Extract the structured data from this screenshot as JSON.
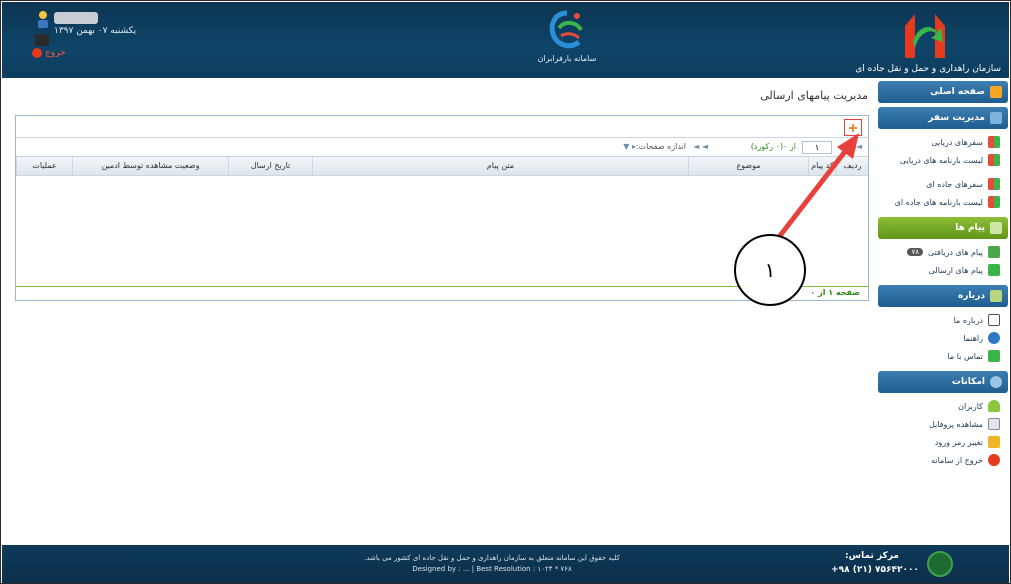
{
  "header": {
    "date": "یکشنبه ۰۷ بهمن ۱۳۹۷",
    "exit_label": "خروج",
    "center_logo_text": "سامانه بارفرابران",
    "org_name": "سازمان راهداری و حمل و نقل جاده ای"
  },
  "sidebar": {
    "home": "صفحه اصلی",
    "trip_management": "مدیریت سفر",
    "trip_items": [
      "سفرهای دریایی",
      "لیست بارنامه های دریایی",
      "سفرهای جاده ای",
      "لیست بارنامه های جاده ای"
    ],
    "messages": "پیام ها",
    "received_messages": "پیام های دریافتی",
    "received_badge": "۷۸",
    "sent_messages": "پیام های ارسالی",
    "about": "درباره",
    "about_items": [
      "درباره ما",
      "راهنما",
      "تماس با ما"
    ],
    "facilities": "امکانات",
    "facility_items": [
      "کاربران",
      "مشاهده پروفایل",
      "تغییر رمز ورود",
      "خروج از سامانه"
    ]
  },
  "main": {
    "page_title": "مدیریت پیامهای ارسالی",
    "pager": {
      "page_value": "۱",
      "of_text": "از ۰(۰ رکورد)",
      "page_size_label": "اندازه صفحات:"
    },
    "columns": [
      "ردیف",
      "کد پیام",
      "موضوع",
      "متن پیام",
      "تاریخ ارسال",
      "وضعیت مشاهده توسط ادمین",
      "عملیات"
    ],
    "page_status": "صفحه ۱ از ۰"
  },
  "annotation": {
    "label": "۱"
  },
  "footer": {
    "copyright_line1": "کلیه حقوق این سامانه متعلق به سازمان راهداری و حمل و نقل جاده ای کشور می باشد.",
    "copyright_line2": "Designed by : ... | Best Resolution : ۱۰۲۴ * ۷۶۸",
    "contact_label": "مرکز تماس:",
    "contact_phone": "+۹۸ (۲۱) ۷۵۶۴۲۰۰۰"
  },
  "colors": {
    "header_bg": "#0f4468",
    "sidebar_blue": "#1f5d8f",
    "sidebar_green": "#62941b",
    "annotation_red": "#e8413b"
  }
}
